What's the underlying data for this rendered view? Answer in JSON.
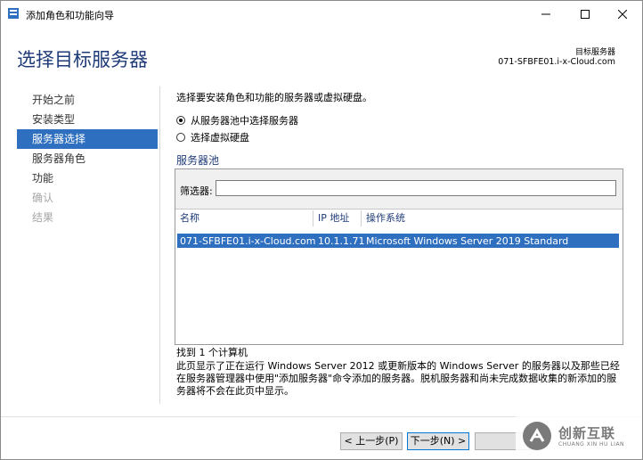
{
  "window": {
    "title": "添加角色和功能向导",
    "minimize_icon": "minimize-icon",
    "maximize_icon": "maximize-icon",
    "close_icon": "close-icon"
  },
  "header": {
    "title": "选择目标服务器",
    "destination_label": "目标服务器",
    "destination_server": "071-SFBFE01.i-x-Cloud.com"
  },
  "nav": {
    "items": [
      {
        "label": "开始之前",
        "state": "normal"
      },
      {
        "label": "安装类型",
        "state": "normal"
      },
      {
        "label": "服务器选择",
        "state": "active"
      },
      {
        "label": "服务器角色",
        "state": "normal"
      },
      {
        "label": "功能",
        "state": "normal"
      },
      {
        "label": "确认",
        "state": "disabled"
      },
      {
        "label": "结果",
        "state": "disabled"
      }
    ]
  },
  "main": {
    "intro": "选择要安装角色和功能的服务器或虚拟硬盘。",
    "radio_pool": "从服务器池中选择服务器",
    "radio_vhd": "选择虚拟硬盘",
    "selected_option": "pool",
    "pool_title": "服务器池",
    "filter_label": "筛选器:",
    "filter_value": "",
    "columns": [
      "名称",
      "IP 地址",
      "操作系统"
    ],
    "rows": [
      {
        "name": "071-SFBFE01.i-x-Cloud.com",
        "ip": "10.1.1.71",
        "os": "Microsoft Windows Server 2019 Standard"
      }
    ],
    "found": "找到 1 个计算机",
    "description": "此页显示了正在运行 Windows Server 2012 或更新版本的 Windows Server 的服务器以及那些已经在服务器管理器中使用\"添加服务器\"命令添加的服务器。脱机服务器和尚未完成数据收集的新添加的服务器将不会在此页中显示。"
  },
  "footer": {
    "back": "< 上一步(P)",
    "next": "下一步(N) >"
  },
  "watermark": {
    "text": "创新互联",
    "subtext": "CHUANG XIN HU LIAN"
  },
  "colors": {
    "accent": "#2f6fbf",
    "title_blue": "#1e3a78"
  }
}
